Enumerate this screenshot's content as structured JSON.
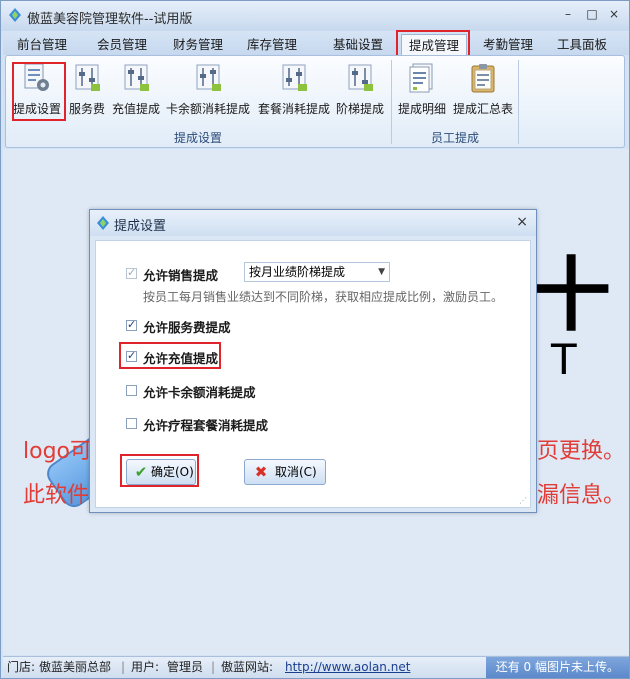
{
  "window": {
    "title": "傲蓝美容院管理软件--试用版",
    "minimize": "–",
    "maximize": "□",
    "close": "×"
  },
  "tabs": [
    "前台管理",
    "会员管理",
    "财务管理",
    "库存管理",
    "基础设置",
    "提成管理",
    "考勤管理",
    "工具面板"
  ],
  "active_tab": "提成管理",
  "ribbon": {
    "group1_label": "提成设置",
    "group2_label": "员工提成",
    "buttons": [
      "提成设置",
      "服务费",
      "充值提成",
      "卡余额消耗提成",
      "套餐消耗提成",
      "阶梯提成",
      "提成明细",
      "提成汇总表"
    ]
  },
  "background": {
    "glyph1": "十",
    "glyph2": "T",
    "red_line1_left": "logo可",
    "red_line1_right": "页更换。",
    "red_line2_left": "此软件",
    "red_line2_right": "漏信息。"
  },
  "dialog": {
    "title": "提成设置",
    "close": "×",
    "options": [
      {
        "label": "允许销售提成",
        "checked": true,
        "disabled": true
      },
      {
        "label": "允许服务费提成",
        "checked": true,
        "disabled": false
      },
      {
        "label": "允许充值提成",
        "checked": true,
        "disabled": false
      },
      {
        "label": "允许卡余额消耗提成",
        "checked": false,
        "disabled": false
      },
      {
        "label": "允许疗程套餐消耗提成",
        "checked": false,
        "disabled": false
      }
    ],
    "sales_mode_value": "按月业绩阶梯提成",
    "sales_hint": "按员工每月销售业绩达到不同阶梯，获取相应提成比例，激励员工。",
    "ok_label": "确定(O)",
    "cancel_label": "取消(C)"
  },
  "statusbar": {
    "store_label": "门店:",
    "store_value": "傲蓝美丽总部",
    "user_label": "用户:",
    "user_value": "管理员",
    "site_label": "傲蓝网站:",
    "site_url": "http://www.aolan.net",
    "upload_status": "还有 0 幅图片未上传。"
  },
  "colors": {
    "highlight_red": "#e0242b",
    "brand_blue": "#5b9be0",
    "background_red_text": "#e23c36"
  },
  "icons": {
    "app": "app-logo-icon",
    "ok": "check-icon",
    "cancel": "x-icon"
  }
}
